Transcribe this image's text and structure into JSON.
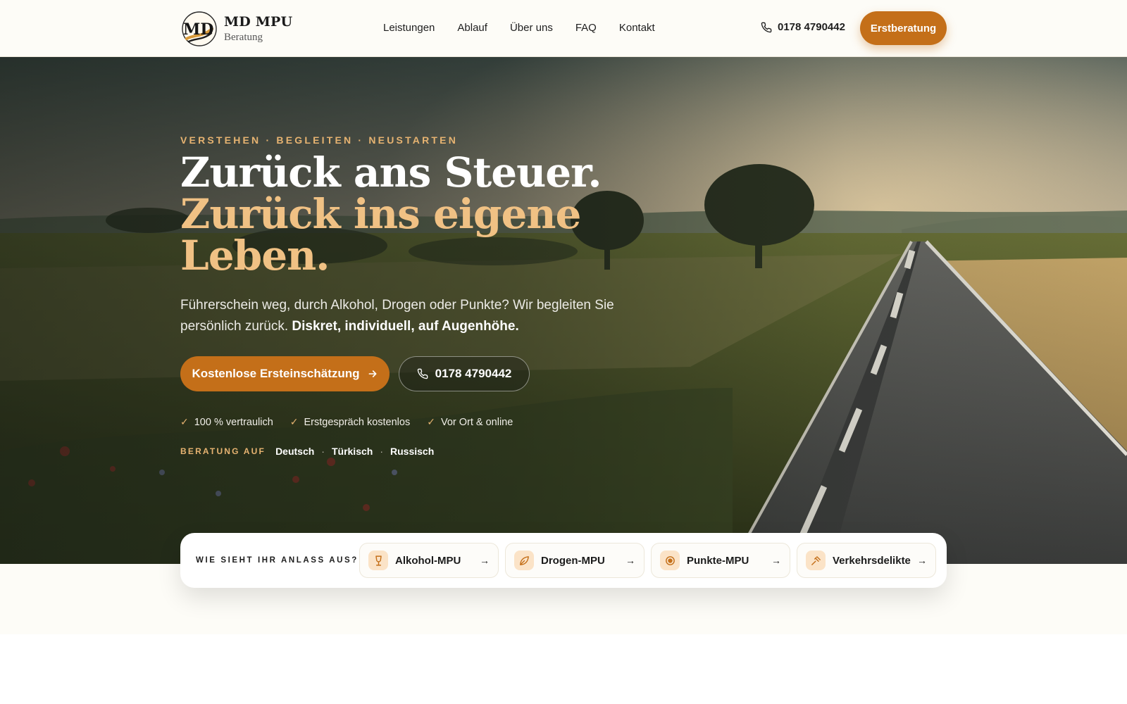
{
  "brand": {
    "name": "MD MPU",
    "subtitle": "Beratung",
    "logo_monogram": "MD"
  },
  "nav": {
    "items": [
      "Leistungen",
      "Ablauf",
      "Über uns",
      "FAQ",
      "Kontakt"
    ]
  },
  "header": {
    "phone": "0178 4790442",
    "cta_label": "Erstberatung"
  },
  "hero": {
    "kicker": "VERSTEHEN · BEGLEITEN · NEUSTARTEN",
    "headline_line1": "Zurück ans Steuer.",
    "headline_line2": "Zurück ins eigene",
    "headline_line3": "Leben.",
    "lead_text": "Führerschein weg, durch Alkohol, Drogen oder Punkte? Wir begleiten Sie persönlich zurück.",
    "lead_strong": "Diskret, individuell, auf Augenhöhe.",
    "primary_cta": "Kostenlose Ersteinschätzung",
    "phone_cta": "0178 4790442",
    "checks": [
      "100 % vertraulich",
      "Erstgespräch kostenlos",
      "Vor Ort & online"
    ],
    "languages_label": "BERATUNG AUF",
    "languages": [
      "Deutsch",
      "Türkisch",
      "Russisch"
    ]
  },
  "anlass": {
    "label": "WIE SIEHT IHR ANLASS AUS?",
    "cards": [
      {
        "label": "Alkohol-MPU",
        "icon": "glass-icon"
      },
      {
        "label": "Drogen-MPU",
        "icon": "leaf-icon"
      },
      {
        "label": "Punkte-MPU",
        "icon": "target-icon"
      },
      {
        "label": "Verkehrsdelikte",
        "icon": "gavel-icon"
      }
    ]
  },
  "colors": {
    "accent": "#c46f19",
    "accent_light": "#f0c184",
    "kicker": "#e6b371",
    "page_bg": "#fdfcf7"
  }
}
